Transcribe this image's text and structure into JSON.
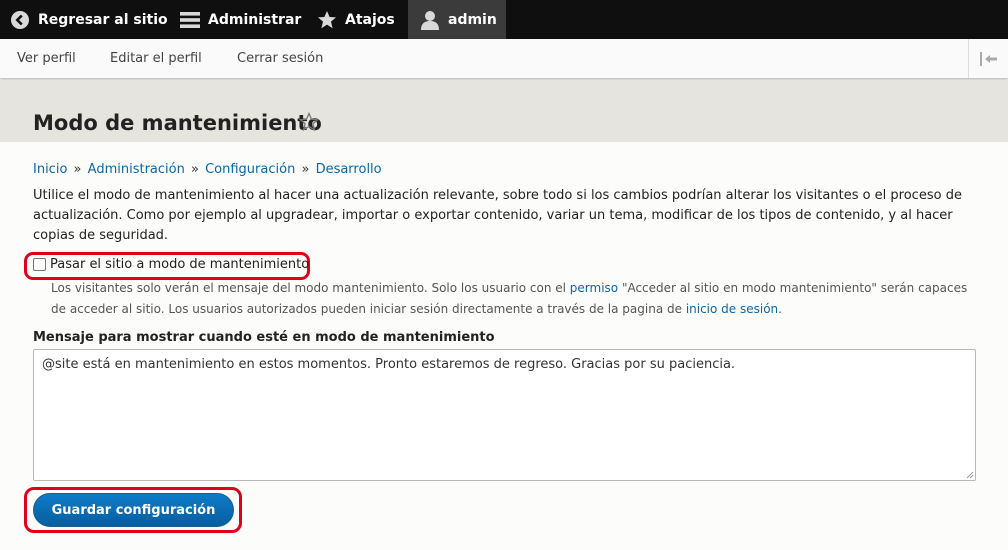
{
  "toolbar": {
    "back_label": "Regresar al sitio",
    "manage_label": "Administrar",
    "shortcuts_label": "Atajos",
    "user_label": "admin"
  },
  "tray": {
    "view_profile": "Ver perfil",
    "edit_profile": "Editar el perfil",
    "logout": "Cerrar sesión"
  },
  "page": {
    "title": "Modo de mantenimiento"
  },
  "breadcrumb": {
    "items": [
      "Inicio",
      "Administración",
      "Configuración",
      "Desarrollo"
    ],
    "separator": "»"
  },
  "description": "Utilice el modo de mantenimiento al hacer una actualización relevante, sobre todo si los cambios podrían alterar los visitantes o el proceso de actualización. Como por ejemplo al upgradear, importar o exportar contenido, variar un tema, modificar de los tipos de contenido, y al hacer copias de seguridad.",
  "maintenance_checkbox": {
    "label": "Pasar el sitio a modo de mantenimiento",
    "checked": false,
    "help_1": "Los visitantes solo verán el mensaje del modo mantenimiento. Solo los usuario con el ",
    "help_link_1": "permiso",
    "help_2": " \"Acceder al sitio en modo mantenimiento\" serán capaces de acceder al sitio. Los usuarios autorizados pueden iniciar sesión directamente a través de la pagina de ",
    "help_link_2": "inicio de sesión",
    "help_3": "."
  },
  "message": {
    "label": "Mensaje para mostrar cuando esté en modo de mantenimiento",
    "value": "@site está en mantenimiento en estos momentos. Pronto estaremos de regreso. Gracias por su paciencia."
  },
  "submit": {
    "label": "Guardar configuración"
  },
  "colors": {
    "toolbar_bg": "#0f0f0f",
    "link": "#0a66a8",
    "highlight": "#e0001b",
    "button": "#0a6fb8"
  }
}
